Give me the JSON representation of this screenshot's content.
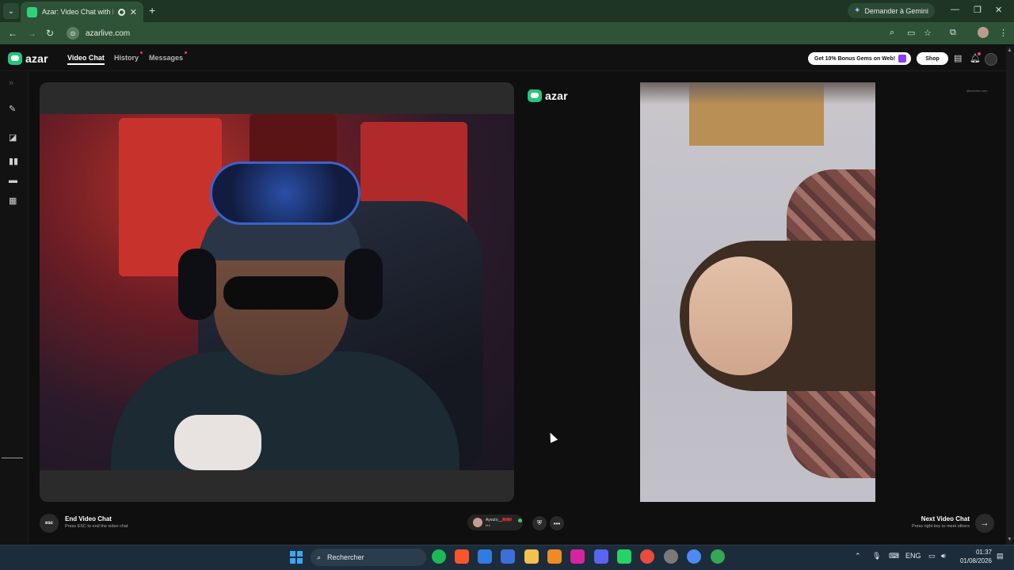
{
  "browser": {
    "tab_title": "Azar: Video Chat with New",
    "url": "azarlive.com",
    "gemini_label": "Demander à Gemini"
  },
  "header": {
    "logo_text": "azar",
    "nav": {
      "video_chat": "Video Chat",
      "history": "History",
      "messages": "Messages"
    },
    "promo_label": "Get 10% Bonus Gems on Web!",
    "shop_label": "Shop"
  },
  "remote": {
    "logo_text": "azar",
    "watermark": "@azarlive.com"
  },
  "controls": {
    "esc_label": "esc",
    "end_title": "End Video Chat",
    "end_sub": "Press ESC to end the video chat",
    "partner_name": "Ayouto__🇲🇦🇲🇦",
    "partner_country": "MA",
    "next_title": "Next Video Chat",
    "next_sub": "Press right key to meet others"
  },
  "taskbar": {
    "search_label": "Rechercher",
    "lang": "ENG",
    "time": "01:37",
    "date": "01/08/2026"
  },
  "colors": {
    "brand_green": "#22c77c",
    "chrome_green": "#2f5337",
    "page_bg": "#0f0f0f"
  }
}
